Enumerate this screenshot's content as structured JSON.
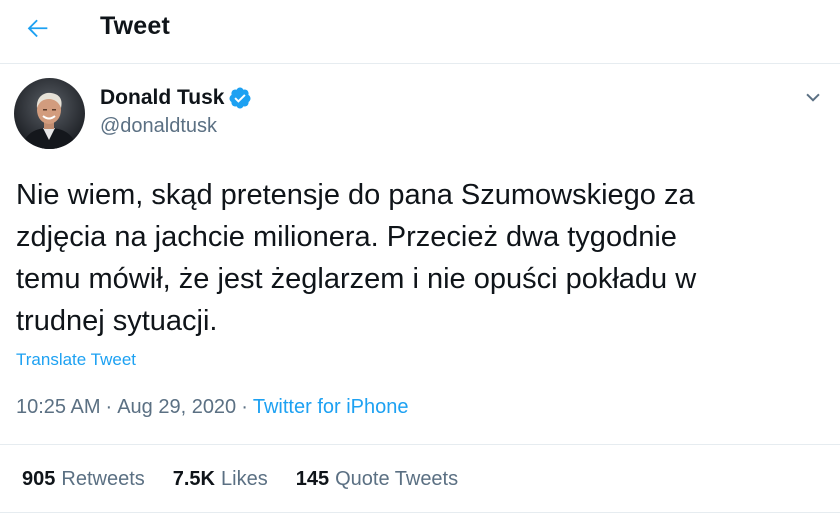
{
  "header": {
    "title": "Tweet",
    "back_icon": "arrow-left-icon",
    "accent_color": "#1da1f2"
  },
  "author": {
    "name": "Donald Tusk",
    "handle": "@donaldtusk",
    "verified": true,
    "avatar_icon": "profile-photo"
  },
  "tweet": {
    "lines": [
      "Nie wiem, skąd pretensje do pana Szumowskiego za",
      "zdjęcia na jachcie milionera. Przecież dwa tygodnie",
      "temu mówił, że jest żeglarzem i nie opuści pokładu w",
      "trudnej sytuacji."
    ],
    "translate_label": "Translate Tweet"
  },
  "meta": {
    "time": "10:25 AM",
    "separator": "·",
    "date": "Aug 29, 2020",
    "source": "Twitter for iPhone"
  },
  "stats": [
    {
      "count": "905",
      "label": "Retweets"
    },
    {
      "count": "7.5K",
      "label": "Likes"
    },
    {
      "count": "145",
      "label": "Quote Tweets"
    }
  ]
}
